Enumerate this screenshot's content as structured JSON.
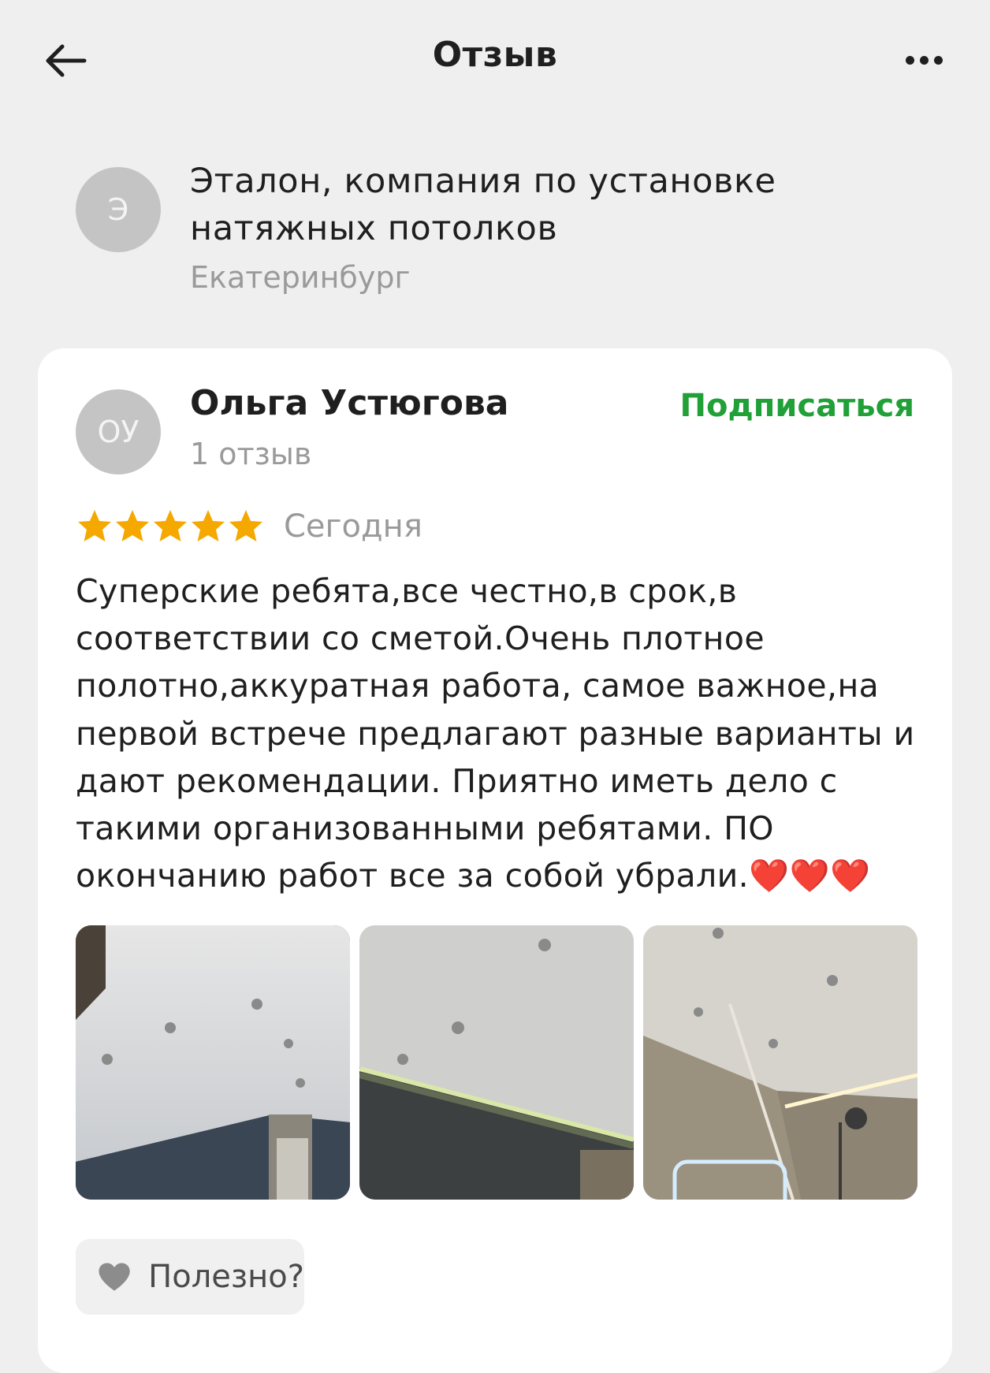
{
  "header": {
    "title": "Отзыв",
    "back_icon": "arrow-left-icon",
    "more_icon": "more-horizontal-icon"
  },
  "organization": {
    "avatar_letter": "Э",
    "name_line1": "Эталон, компания по установке",
    "name_line2": "натяжных потолков",
    "city": "Екатеринбург"
  },
  "review": {
    "author": {
      "initials": "ОУ",
      "name": "Ольга Устюгова",
      "reviews_count": "1 отзыв",
      "subscribe_label": "Подписаться"
    },
    "rating": 5,
    "rating_max": 5,
    "date": "Сегодня",
    "text_lines": [
      "Суперские ребята,все честно,в срок,в",
      "соответствии со сметой.Очень плотное",
      "полотно,аккуратная работа, самое важное,на",
      "первой встрече предлагают разные варианты и",
      "дают рекомендации. Приятно иметь дело с",
      "такими организованными ребятами. ПО",
      "окончанию работ все за собой убрали.❤️❤️❤️"
    ],
    "photos_count": 3,
    "useful_label": "Полезно?",
    "useful_icon": "heart-icon"
  },
  "colors": {
    "background": "#efefef",
    "card": "#ffffff",
    "accent_green": "#21a038",
    "star": "#f5a800",
    "muted_text": "#9a9a9a",
    "avatar_bg": "#c4c4c4"
  }
}
